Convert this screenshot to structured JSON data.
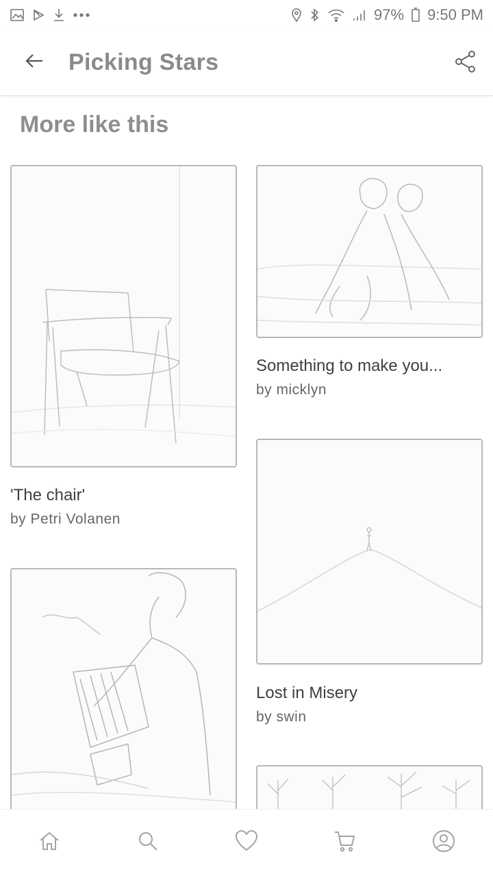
{
  "status_bar": {
    "battery": "97%",
    "time": "9:50 PM",
    "left_icons": [
      "gallery-icon",
      "play-store-icon",
      "download-icon",
      "more-dots-icon"
    ],
    "right_icons": [
      "location-icon",
      "bluetooth-icon",
      "wifi-icon",
      "signal-icon",
      "battery-icon"
    ]
  },
  "app_bar": {
    "title": "Picking Stars",
    "back_icon": "arrow-left-icon",
    "share_icon": "share-icon"
  },
  "section": {
    "title": "More like this"
  },
  "cards": [
    {
      "title": "'The chair'",
      "author": "by Petri Volanen"
    },
    {
      "title": "Something to make you...",
      "author": "by micklyn"
    },
    {
      "title": "Lost in Misery",
      "author": "by swin"
    },
    {
      "title": "",
      "author": ""
    },
    {
      "title": "",
      "author": ""
    }
  ],
  "bottom_nav": {
    "items": [
      "home-icon",
      "search-icon",
      "heart-icon",
      "cart-icon",
      "profile-icon"
    ]
  }
}
